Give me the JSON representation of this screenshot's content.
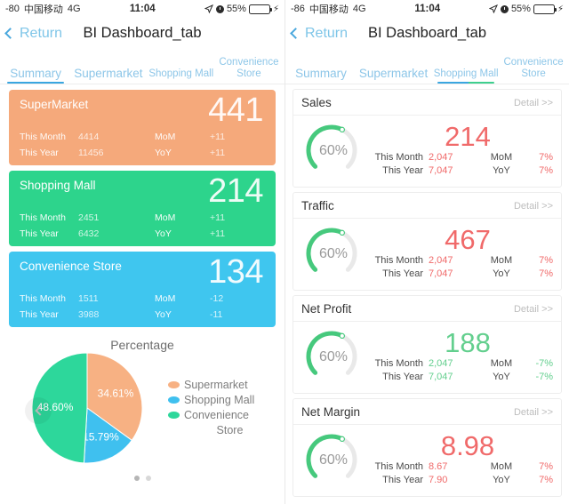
{
  "left": {
    "status": {
      "signal": "-80",
      "carrier": "中国移动",
      "network": "4G",
      "time": "11:04",
      "battery": "55%",
      "location_icon": "location-arrow-icon",
      "alarm_icon": "alarm-clock-icon",
      "charging_icon": "lightning-bolt-icon"
    },
    "nav": {
      "back_label": "Return",
      "title": "BI Dashboard_tab",
      "back_icon": "chevron-left-icon"
    },
    "tabs": [
      {
        "label": "Summary",
        "active": true
      },
      {
        "label": "Supermarket",
        "active": false
      },
      {
        "label": "Shopping Mall",
        "active": false
      },
      {
        "label": "Convenience Store",
        "active": false
      }
    ],
    "kpis": [
      {
        "title": "SuperMarket",
        "big": "441",
        "color": "#f5a97b",
        "month_label": "This Month",
        "month_value": "4414",
        "year_label": "This Year",
        "year_value": "11456",
        "mom_label": "MoM",
        "mom_value": "+11",
        "yoy_label": "YoY",
        "yoy_value": "+11"
      },
      {
        "title": "Shopping Mall",
        "big": "214",
        "color": "#2dd48c",
        "month_label": "This Month",
        "month_value": "2451",
        "year_label": "This Year",
        "year_value": "6432",
        "mom_label": "MoM",
        "mom_value": "+11",
        "yoy_label": "YoY",
        "yoy_value": "+11"
      },
      {
        "title": "Convenience Store",
        "big": "134",
        "color": "#3fc6ef",
        "month_label": "This Month",
        "month_value": "1511",
        "year_label": "This Year",
        "year_value": "3988",
        "mom_label": "MoM",
        "mom_value": "-12",
        "yoy_label": "YoY",
        "yoy_value": "-11"
      }
    ],
    "pie_panel": {
      "prev_icon": "chevron-left-circle-icon",
      "pager": {
        "total": 2,
        "current": 1
      }
    }
  },
  "chart_data": {
    "type": "pie",
    "title": "Percentage",
    "categories": [
      "Supermarket",
      "Shopping Mall",
      "Convenience Store"
    ],
    "values": [
      34.61,
      15.79,
      48.6
    ],
    "labels": [
      "34.61%",
      "15.79%",
      "48.60%"
    ],
    "colors": [
      "#f7b183",
      "#3fc0ef",
      "#2dd79b"
    ],
    "legend_position": "right",
    "grid": false,
    "xlabel": "",
    "ylabel": ""
  },
  "right": {
    "status": {
      "signal": "-86",
      "carrier": "中国移动",
      "network": "4G",
      "time": "11:04",
      "battery": "55%",
      "location_icon": "location-arrow-icon",
      "alarm_icon": "alarm-clock-icon",
      "charging_icon": "lightning-bolt-icon"
    },
    "nav": {
      "back_label": "Return",
      "title": "BI Dashboard_tab",
      "back_icon": "chevron-left-icon"
    },
    "tabs": [
      {
        "label": "Summary",
        "active": false
      },
      {
        "label": "Supermarket",
        "active": false
      },
      {
        "label": "Shopping Mall",
        "active": true
      },
      {
        "label": "Convenience Store",
        "active": false
      }
    ],
    "detail_label": "Detail >>",
    "cards": [
      {
        "name": "Sales",
        "gauge": "60%",
        "gauge_percent": 60,
        "big": "214",
        "value_color": "#f06a6a",
        "month_label": "This Month",
        "month_value": "2,047",
        "year_label": "This Year",
        "year_value": "7,047",
        "mom_label": "MoM",
        "mom_value": "7%",
        "yoy_label": "YoY",
        "yoy_value": "7%"
      },
      {
        "name": "Traffic",
        "gauge": "60%",
        "gauge_percent": 60,
        "big": "467",
        "value_color": "#f06a6a",
        "month_label": "This Month",
        "month_value": "2,047",
        "year_label": "This Year",
        "year_value": "7,047",
        "mom_label": "MoM",
        "mom_value": "7%",
        "yoy_label": "YoY",
        "yoy_value": "7%"
      },
      {
        "name": "Net Profit",
        "gauge": "60%",
        "gauge_percent": 60,
        "big": "188",
        "value_color": "#63cf8e",
        "month_label": "This Month",
        "month_value": "2,047",
        "year_label": "This Year",
        "year_value": "7,047",
        "mom_label": "MoM",
        "mom_value": "-7%",
        "yoy_label": "YoY",
        "yoy_value": "-7%"
      },
      {
        "name": "Net Margin",
        "gauge": "60%",
        "gauge_percent": 60,
        "big": "8.98",
        "value_color": "#f06a6a",
        "month_label": "This Month",
        "month_value": "8.67",
        "year_label": "This Year",
        "year_value": "7.90",
        "mom_label": "MoM",
        "mom_value": "7%",
        "yoy_label": "YoY",
        "yoy_value": "7%"
      }
    ]
  }
}
